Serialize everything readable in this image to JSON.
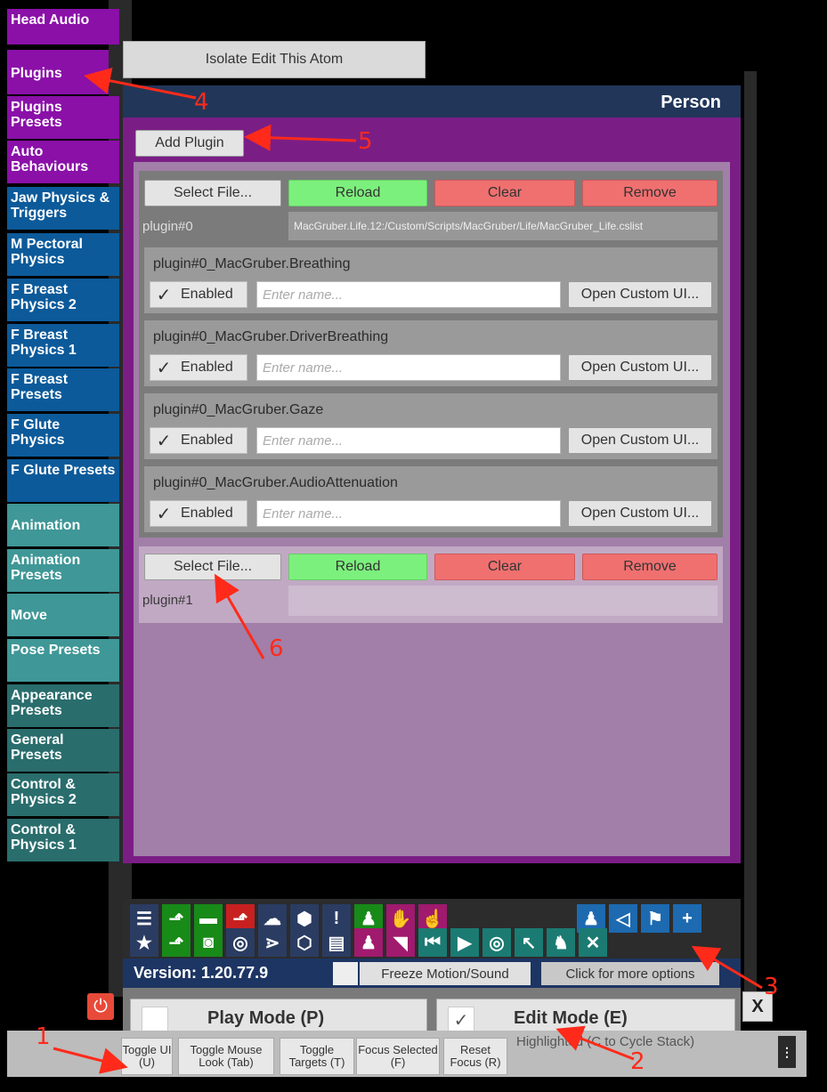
{
  "left_tabs": [
    {
      "label": "Head Audio"
    },
    {
      "label": "Plugins"
    },
    {
      "label": "Plugins Presets"
    },
    {
      "label": "Auto Behaviours"
    },
    {
      "label": "Jaw Physics & Triggers"
    },
    {
      "label": "M Pectoral Physics"
    },
    {
      "label": "F Breast Physics 2"
    },
    {
      "label": "F Breast Physics 1"
    },
    {
      "label": "F Breast Presets"
    },
    {
      "label": "F Glute Physics"
    },
    {
      "label": "F Glute Presets"
    },
    {
      "label": "Animation"
    },
    {
      "label": "Animation Presets"
    },
    {
      "label": "Move"
    },
    {
      "label": "Pose Presets"
    },
    {
      "label": "Appearance Presets"
    },
    {
      "label": "General Presets"
    },
    {
      "label": "Control & Physics 2"
    },
    {
      "label": "Control & Physics 1"
    }
  ],
  "isolate_button": "Isolate Edit This Atom",
  "panel_title": "Person",
  "add_plugin": "Add Plugin",
  "plugin0": {
    "select_file": "Select File...",
    "reload": "Reload",
    "clear": "Clear",
    "remove": "Remove",
    "id": "plugin#0",
    "path": "MacGruber.Life.12:/Custom/Scripts/MacGruber/Life/MacGruber_Life.cslist",
    "subplugins": [
      {
        "name": "plugin#0_MacGruber.Breathing"
      },
      {
        "name": "plugin#0_MacGruber.DriverBreathing"
      },
      {
        "name": "plugin#0_MacGruber.Gaze"
      },
      {
        "name": "plugin#0_MacGruber.AudioAttenuation"
      }
    ],
    "enabled_label": "Enabled",
    "name_placeholder": "Enter name...",
    "custom_ui_label": "Open Custom UI..."
  },
  "plugin1": {
    "select_file": "Select File...",
    "reload": "Reload",
    "clear": "Clear",
    "remove": "Remove",
    "id": "plugin#1"
  },
  "version": "Version: 1.20.77.9",
  "freeze_label": "Freeze Motion/Sound",
  "more_options": "Click for more options",
  "play_mode": "Play Mode (P)",
  "edit_mode": "Edit Mode (E)",
  "close_label": "X",
  "bottom": {
    "toggle_ui": "Toggle UI (U)",
    "toggle_mouse": "Toggle Mouse Look (Tab)",
    "toggle_targets": "Toggle Targets (T)",
    "focus_selected": "Focus Selected (F)",
    "reset_focus": "Reset Focus (R)",
    "highlighted": "Highlighted (C to Cycle Stack)"
  },
  "annotations": [
    "1",
    "2",
    "3",
    "4",
    "5",
    "6"
  ],
  "colors": {
    "purple_tab": "#8a10a8",
    "blue_tab": "#0c5a9a",
    "teal_tab": "#3f9797",
    "panel_purple": "#7a1e86",
    "header_navy": "#22365a",
    "annotation_red": "#ff2a1a"
  }
}
